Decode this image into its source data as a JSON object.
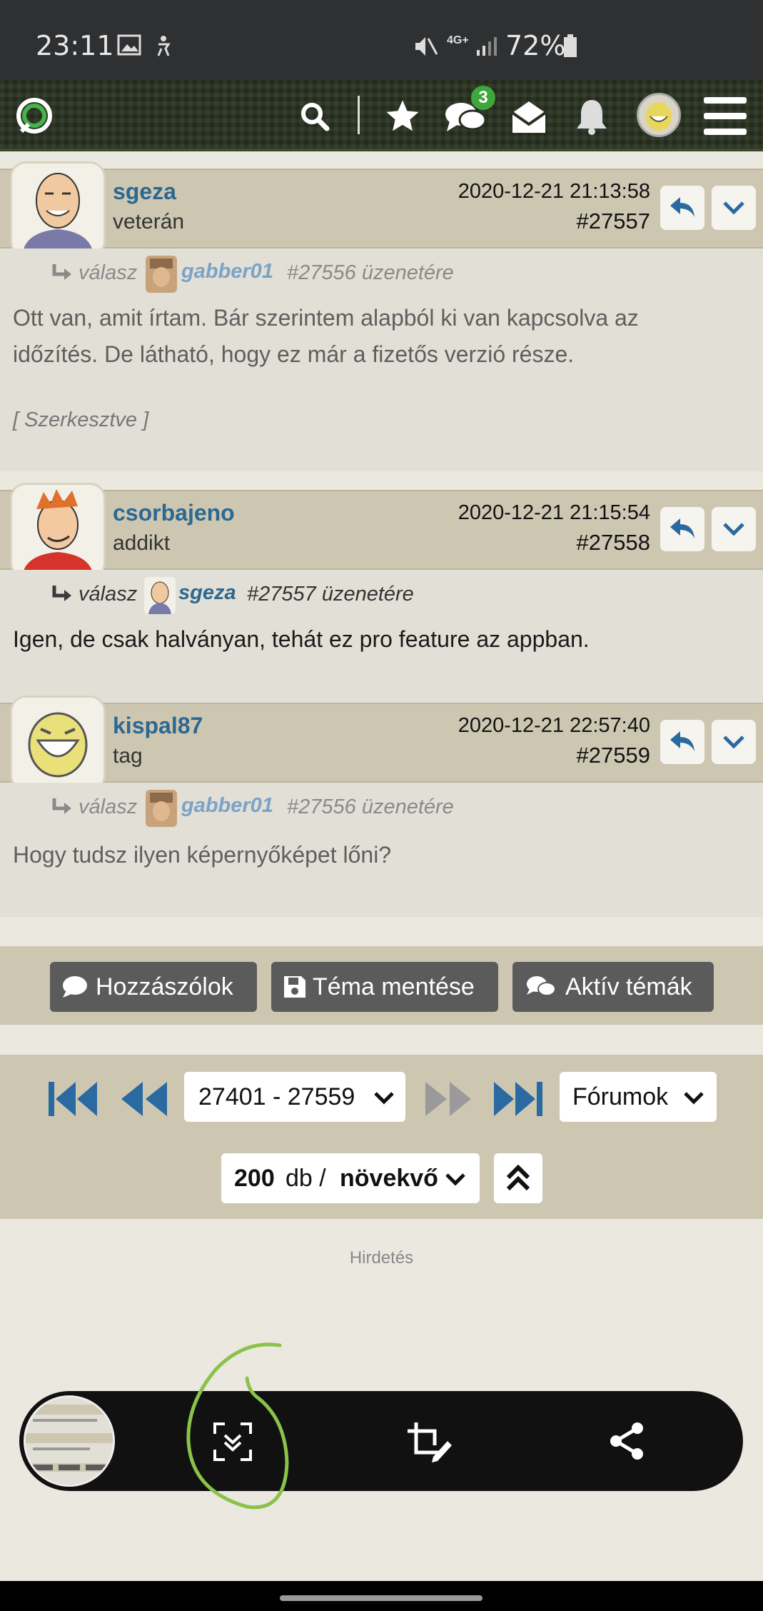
{
  "status_bar": {
    "time": "23:11",
    "network": "4G+",
    "battery": "72%"
  },
  "header": {
    "messages_badge": "3",
    "icons": [
      "logo-icon",
      "search-icon",
      "star-icon",
      "chat-icon",
      "envelope-icon",
      "bell-icon",
      "avatar",
      "menu-icon"
    ]
  },
  "posts": [
    {
      "username": "sgeza",
      "rank": "veterán",
      "date": "2020-12-21 21:13:58",
      "number": "#27557",
      "reply_label": "válasz",
      "reply_user": "gabber01",
      "reply_rest": "#27556 üzenetére",
      "text_lines": [
        "Ott van, amit írtam. Bár szerintem alapból ki van kapcsolva az",
        "időzítés. De látható, hogy ez már a fizetős verzió része."
      ],
      "edited": "[ Szerkesztve ]"
    },
    {
      "username": "csorbajeno",
      "rank": "addikt",
      "date": "2020-12-21 21:15:54",
      "number": "#27558",
      "reply_label": "válasz",
      "reply_user": "sgeza",
      "reply_rest": "#27557 üzenetére",
      "text_lines": [
        "Igen, de csak halványan, tehát ez pro feature az appban."
      ]
    },
    {
      "username": "kispal87",
      "rank": "tag",
      "date": "2020-12-21 22:57:40",
      "number": "#27559",
      "reply_label": "válasz",
      "reply_user": "gabber01",
      "reply_rest": "#27556 üzenetére",
      "text_lines": [
        "Hogy tudsz ilyen képernyőképet lőni?"
      ]
    }
  ],
  "actions": {
    "comments": "Hozzászólok",
    "save_topic": "Téma mentése",
    "active_topics": "Aktív témák"
  },
  "pager": {
    "range": "27401 - 27559",
    "forums": "Fórumok",
    "count": "200",
    "count_unit": "db /",
    "order": "növekvő"
  },
  "ad_label": "Hirdetés",
  "colors": {
    "username": "#2d6891",
    "header_bg": "#cdc7b2",
    "accent_blue": "#2a6aa0",
    "badge": "#3fa63c",
    "annotation": "#8ac24a"
  }
}
